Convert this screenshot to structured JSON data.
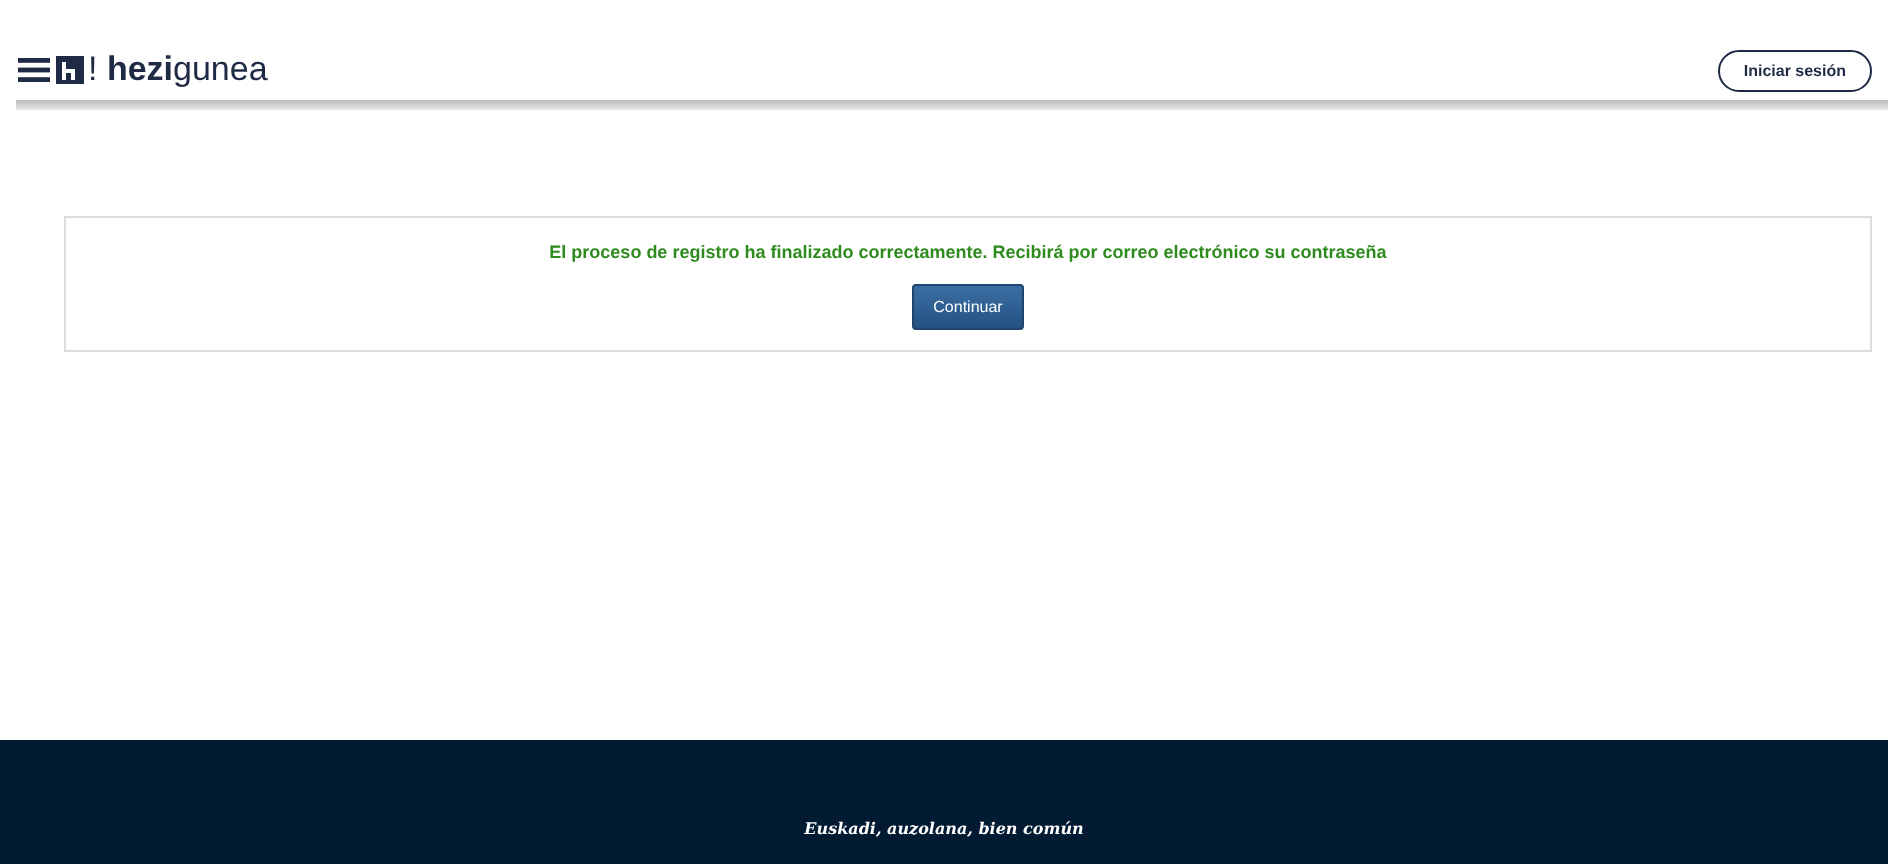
{
  "header": {
    "logo": "! **hezi**gunea",
    "login_button": "Iniciar sesión"
  },
  "message": {
    "text": "El proceso de registro ha finalizado correctamente. Recibirá por correo electrónico su contraseña",
    "button": "Continuar"
  },
  "footer": {
    "motto": "Euskadi, auzolana, bien común"
  }
}
